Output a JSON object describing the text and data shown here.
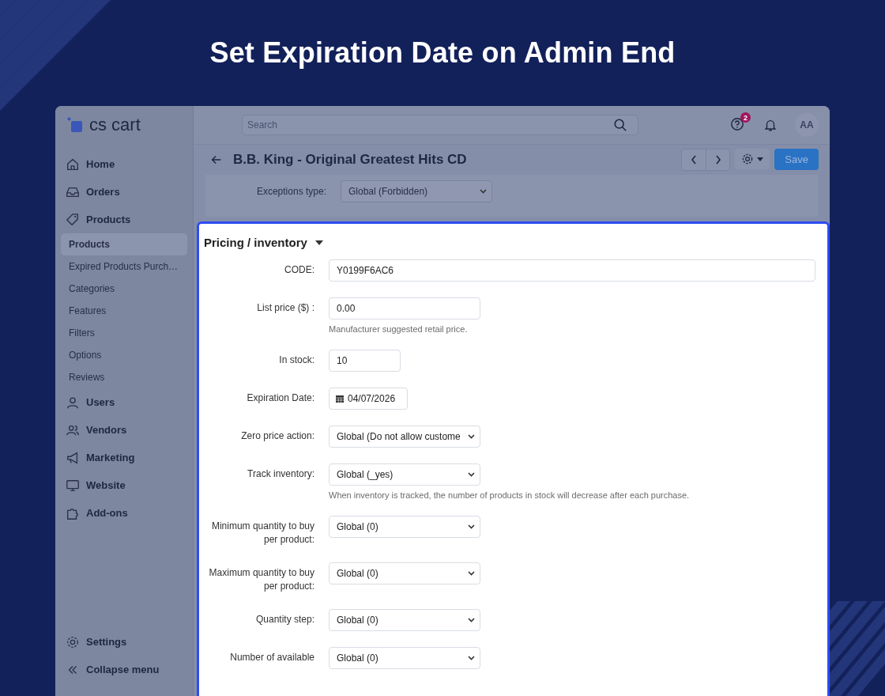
{
  "banner": {
    "title": "Set Expiration Date on Admin End"
  },
  "logo": {
    "text": "cs cart"
  },
  "sidebar": {
    "items": [
      {
        "label": "Home",
        "kind": "main",
        "selected": false
      },
      {
        "label": "Orders",
        "kind": "main",
        "selected": false
      },
      {
        "label": "Products",
        "kind": "main",
        "selected": false
      },
      {
        "label": "Products",
        "kind": "sub",
        "selected": true
      },
      {
        "label": "Expired Products Purch…",
        "kind": "sub",
        "selected": false
      },
      {
        "label": "Categories",
        "kind": "sub",
        "selected": false
      },
      {
        "label": "Features",
        "kind": "sub",
        "selected": false
      },
      {
        "label": "Filters",
        "kind": "sub",
        "selected": false
      },
      {
        "label": "Options",
        "kind": "sub",
        "selected": false
      },
      {
        "label": "Reviews",
        "kind": "sub",
        "selected": false
      },
      {
        "label": "Users",
        "kind": "main",
        "selected": false
      },
      {
        "label": "Vendors",
        "kind": "main",
        "selected": false
      },
      {
        "label": "Marketing",
        "kind": "main",
        "selected": false
      },
      {
        "label": "Website",
        "kind": "main",
        "selected": false
      },
      {
        "label": "Add-ons",
        "kind": "main",
        "selected": false
      }
    ],
    "bottom_items": [
      {
        "label": "Settings"
      },
      {
        "label": "Collapse menu"
      }
    ]
  },
  "topbar": {
    "search": {
      "placeholder": "Search"
    },
    "help_badge": "2",
    "avatar": "AA"
  },
  "page": {
    "title": "B.B. King - Original Greatest Hits CD",
    "save_button": "Save"
  },
  "exceptions": {
    "label": "Exceptions type:",
    "value": "Global (Forbidden)"
  },
  "panel": {
    "title": "Pricing / inventory",
    "fields": [
      {
        "label": "CODE:",
        "kind": "wide_input",
        "value": "Y0199F6AC6"
      },
      {
        "label": "List price ($) :",
        "kind": "input",
        "value": "0.00",
        "hint": "Manufacturer suggested retail price."
      },
      {
        "label": "In stock:",
        "kind": "short_input",
        "value": "10"
      },
      {
        "label": "Expiration Date:",
        "kind": "date",
        "value": "04/07/2026"
      },
      {
        "label": "Zero price action:",
        "kind": "select",
        "value": "Global (Do not allow custome"
      },
      {
        "label": "Track inventory:",
        "kind": "select",
        "value": "Global (_yes)",
        "hint": "When inventory is tracked, the number of products in stock will decrease after each purchase."
      },
      {
        "label": "Minimum quantity to buy per product:",
        "kind": "select",
        "value": "Global (0)"
      },
      {
        "label": "Maximum quantity to buy per product:",
        "kind": "select",
        "value": "Global (0)"
      },
      {
        "label": "Quantity step:",
        "kind": "select",
        "value": "Global (0)"
      },
      {
        "label": "Number of available",
        "kind": "select",
        "value": "Global (0)"
      }
    ]
  }
}
